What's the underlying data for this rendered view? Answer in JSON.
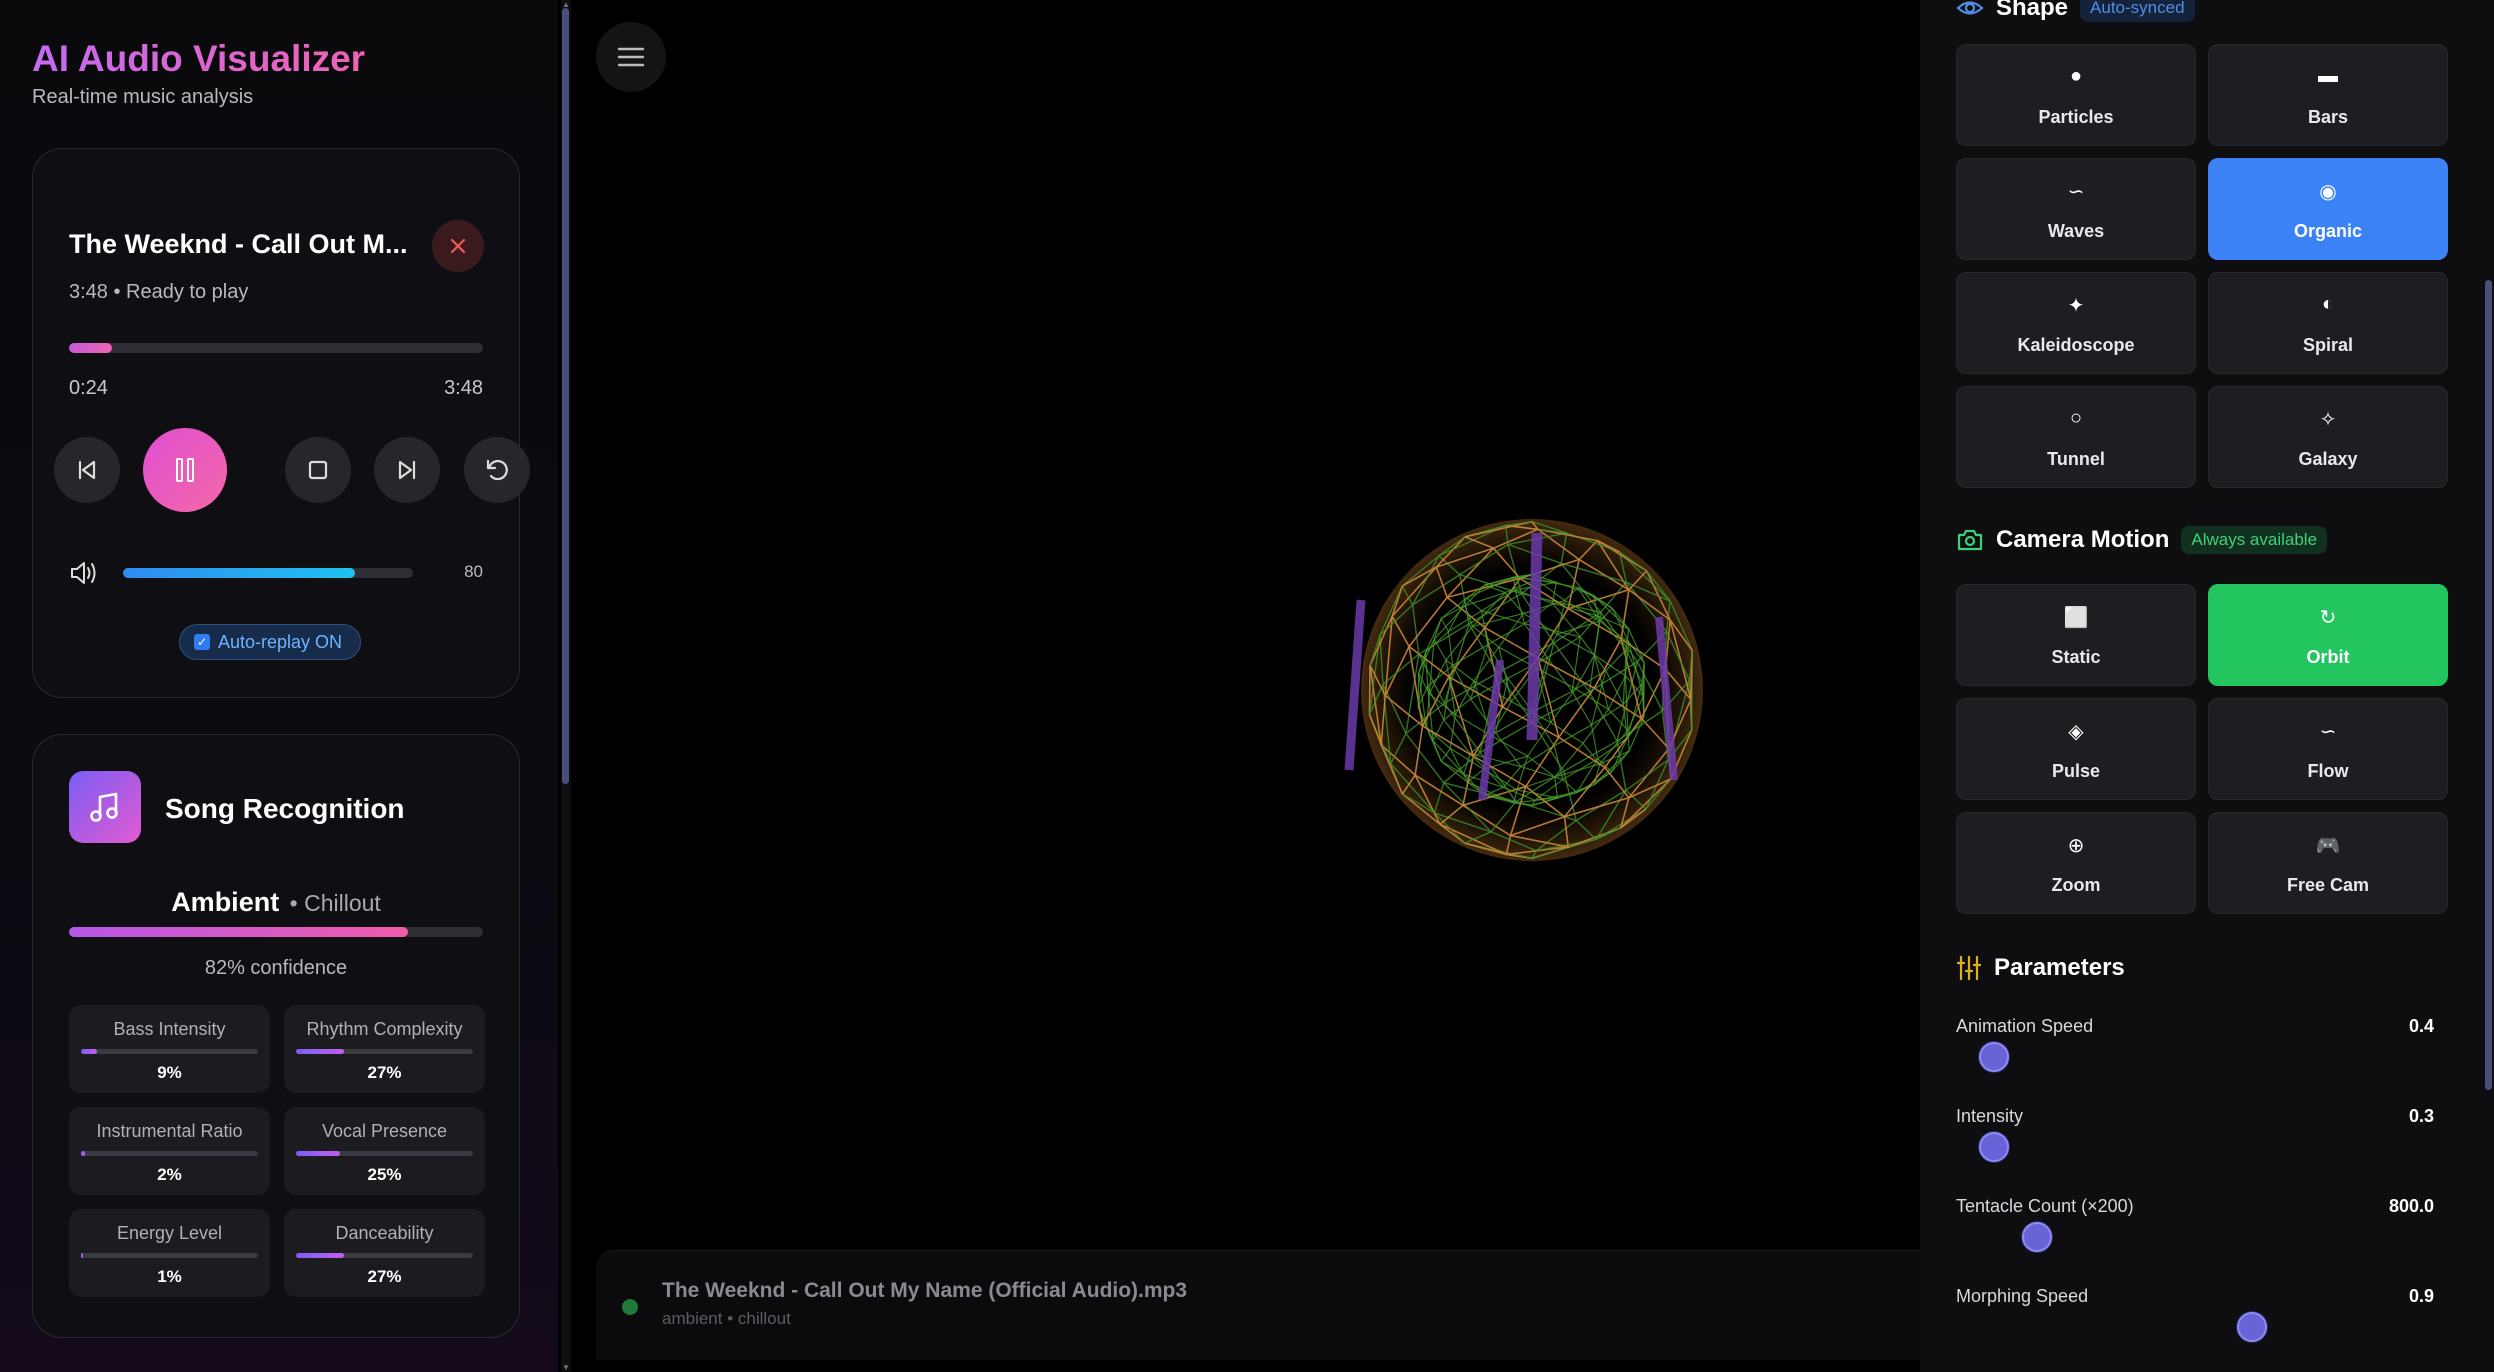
{
  "app": {
    "title": "AI Audio Visualizer",
    "subtitle": "Real-time music analysis"
  },
  "player": {
    "track_title": "The Weeknd - Call Out M...",
    "meta": "3:48 • Ready to play",
    "time_current": "0:24",
    "time_total": "3:48",
    "progress": 0.105,
    "volume": 80,
    "volume_label": "80",
    "autoreplay_label": "Auto-replay ON"
  },
  "recognition": {
    "title": "Song Recognition",
    "genre": "Ambient",
    "subgenre": "• Chillout",
    "confidence": 0.82,
    "confidence_label": "82% confidence",
    "metrics": [
      {
        "label": "Bass Intensity",
        "value": "9%",
        "pct": 9
      },
      {
        "label": "Rhythm Complexity",
        "value": "27%",
        "pct": 27
      },
      {
        "label": "Instrumental Ratio",
        "value": "2%",
        "pct": 2
      },
      {
        "label": "Vocal Presence",
        "value": "25%",
        "pct": 25
      },
      {
        "label": "Energy Level",
        "value": "1%",
        "pct": 1
      },
      {
        "label": "Danceability",
        "value": "27%",
        "pct": 27
      }
    ]
  },
  "now_playing": {
    "file": "The Weeknd - Call Out My Name (Official Audio).mp3",
    "tags": "ambient • chillout"
  },
  "shape": {
    "title": "Shape",
    "badge": "Auto-synced",
    "active": "Organic",
    "options": [
      {
        "label": "Particles",
        "icon": "●"
      },
      {
        "label": "Bars",
        "icon": "▬"
      },
      {
        "label": "Waves",
        "icon": "∽"
      },
      {
        "label": "Organic",
        "icon": "◉"
      },
      {
        "label": "Kaleidoscope",
        "icon": "✦"
      },
      {
        "label": "Spiral",
        "icon": "◐"
      },
      {
        "label": "Tunnel",
        "icon": "○"
      },
      {
        "label": "Galaxy",
        "icon": "✧"
      }
    ]
  },
  "camera": {
    "title": "Camera Motion",
    "badge": "Always available",
    "active": "Orbit",
    "options": [
      {
        "label": "Static",
        "icon": "⬜"
      },
      {
        "label": "Orbit",
        "icon": "↻"
      },
      {
        "label": "Pulse",
        "icon": "◈"
      },
      {
        "label": "Flow",
        "icon": "∽"
      },
      {
        "label": "Zoom",
        "icon": "⊕"
      },
      {
        "label": "Free Cam",
        "icon": "🎮"
      }
    ]
  },
  "parameters": {
    "title": "Parameters",
    "items": [
      {
        "label": "Animation Speed",
        "value": "0.4",
        "level": 0.08
      },
      {
        "label": "Intensity",
        "value": "0.3",
        "level": 0.08
      },
      {
        "label": "Tentacle Count (×200)",
        "value": "800.0",
        "level": 0.17
      },
      {
        "label": "Morphing Speed",
        "value": "0.9",
        "level": 0.62
      }
    ]
  },
  "colors": {
    "accent_pink": "#f062b3",
    "accent_blue": "#3b82f6",
    "accent_green": "#22c55e",
    "slider_thumb": "#6a63d8"
  }
}
